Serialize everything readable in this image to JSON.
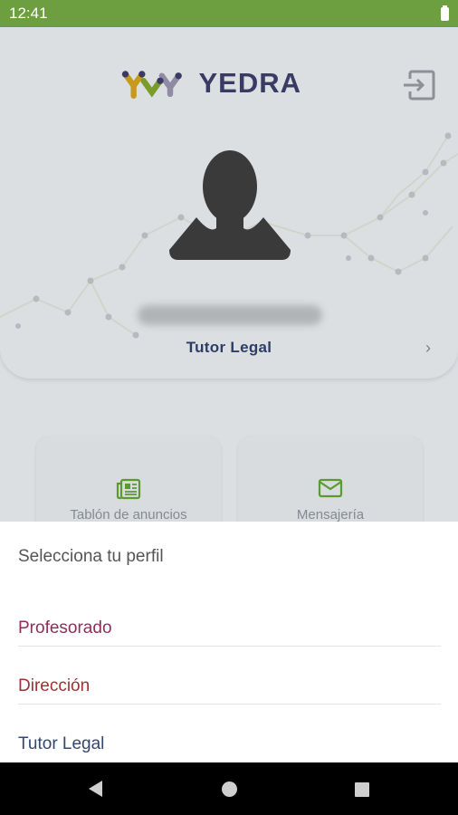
{
  "status_bar": {
    "time": "12:41",
    "battery_icon": "battery-full-icon"
  },
  "header": {
    "logo_text": "YEDRA",
    "logout_icon": "logout-icon"
  },
  "profile": {
    "avatar_icon": "user-avatar-icon",
    "role": "Tutor Legal",
    "chevron_icon": "chevron-right-icon"
  },
  "tiles": [
    {
      "label": "Tablón de anuncios",
      "icon": "newspaper-icon"
    },
    {
      "label": "Mensajería",
      "icon": "mail-icon"
    }
  ],
  "sheet": {
    "title": "Selecciona tu perfil",
    "options": [
      {
        "label": "Profesorado",
        "color": "#8e2f5b"
      },
      {
        "label": "Dirección",
        "color": "#9e3235"
      },
      {
        "label": "Tutor Legal",
        "color": "#34486e"
      }
    ]
  },
  "nav_bar": {
    "back_icon": "back-icon",
    "home_icon": "home-icon",
    "recents_icon": "recents-icon"
  },
  "colors": {
    "status_bar": "#6d9e3f",
    "accent_green": "#5a9a2f",
    "role_text": "#2d3e66"
  }
}
